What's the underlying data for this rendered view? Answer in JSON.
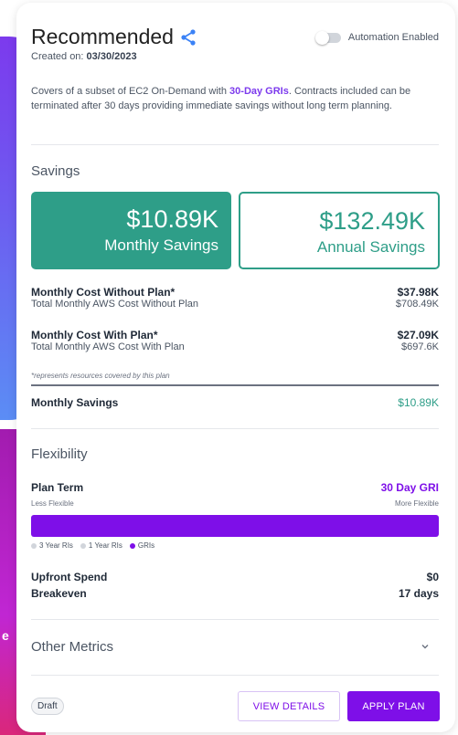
{
  "background": {
    "partial_text_1": "",
    "partial_text_2": "e"
  },
  "header": {
    "title": "Recommended",
    "created_label": "Created on:",
    "created_date": "03/30/2023",
    "automation_label": "Automation Enabled",
    "automation_enabled": false
  },
  "description": {
    "prefix": "Covers of a subset of EC2 On-Demand with ",
    "highlight": "30-Day GRIs",
    "suffix": ". Contracts included can be terminated after 30 days providing immediate savings without long term planning."
  },
  "savings": {
    "section_title": "Savings",
    "monthly_amount": "$10.89K",
    "monthly_label": "Monthly Savings",
    "annual_amount": "$132.49K",
    "annual_label": "Annual Savings",
    "rows": [
      {
        "label": "Monthly Cost Without Plan*",
        "sublabel": "Total Monthly AWS Cost Without Plan",
        "value": "$37.98K",
        "subvalue": "$708.49K"
      },
      {
        "label": "Monthly Cost With Plan*",
        "sublabel": "Total Monthly AWS Cost With Plan",
        "value": "$27.09K",
        "subvalue": "$697.6K"
      }
    ],
    "note": "*represents resources covered by this plan",
    "total_label": "Monthly Savings",
    "total_value": "$10.89K"
  },
  "flexibility": {
    "section_title": "Flexibility",
    "plan_term_label": "Plan Term",
    "plan_term_value": "30 Day GRI",
    "less_flexible": "Less Flexible",
    "more_flexible": "More Flexible",
    "flexibility_level": 1.0,
    "legend": [
      {
        "label": "3 Year RIs",
        "color": "#d1d5db"
      },
      {
        "label": "1 Year RIs",
        "color": "#d1d5db"
      },
      {
        "label": "GRIs",
        "color": "#7e0fe8"
      }
    ],
    "upfront_label": "Upfront Spend",
    "upfront_value": "$0",
    "breakeven_label": "Breakeven",
    "breakeven_value": "17 days"
  },
  "other_metrics": {
    "section_title": "Other Metrics"
  },
  "footer": {
    "status_badge": "Draft",
    "view_details_label": "VIEW DETAILS",
    "apply_plan_label": "APPLY PLAN"
  },
  "colors": {
    "accent_purple": "#7e0fe8",
    "savings_green": "#2e9e88"
  }
}
